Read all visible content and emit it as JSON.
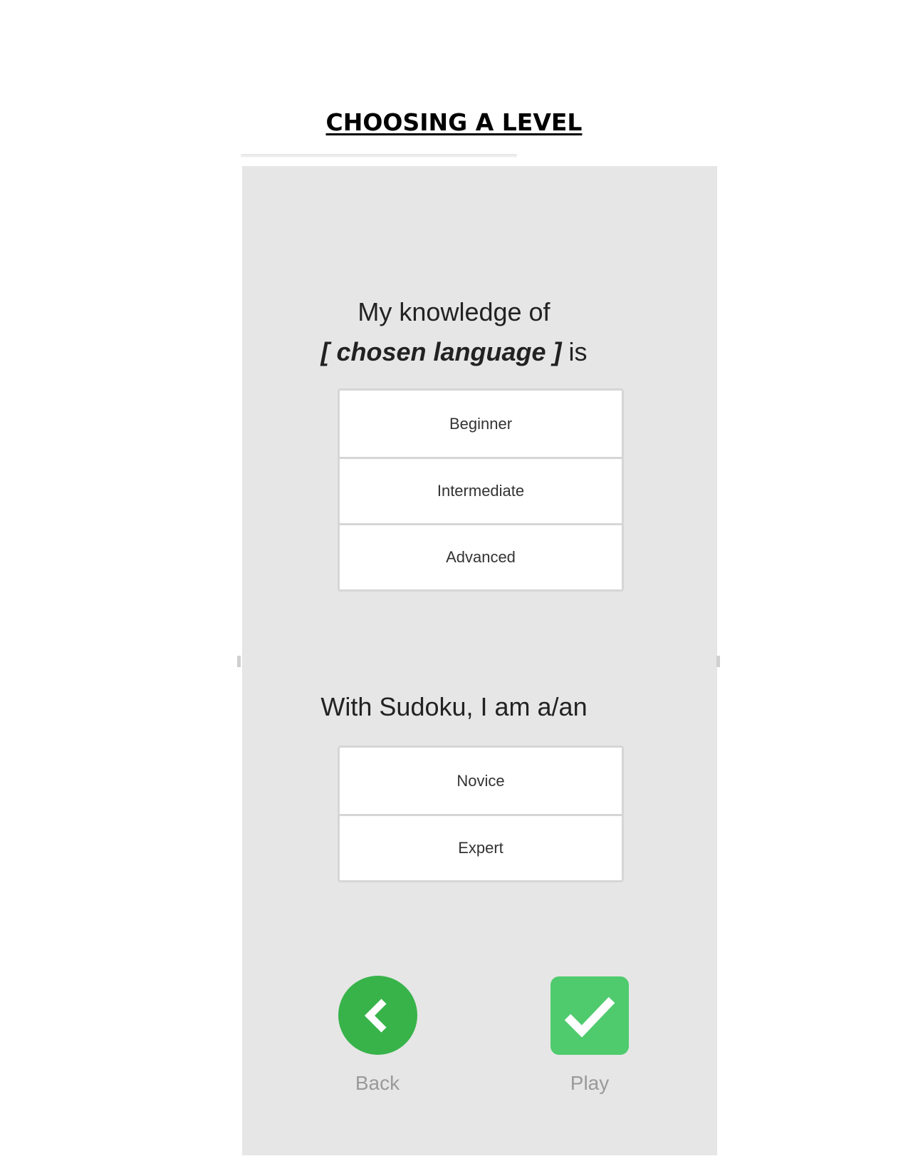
{
  "document": {
    "title": "CHOOSING A LEVEL"
  },
  "screen": {
    "language_question": {
      "line1": "My knowledge of",
      "emphasis": "[ chosen language ]",
      "suffix": " is"
    },
    "language_levels": [
      {
        "label": "Beginner"
      },
      {
        "label": "Intermediate"
      },
      {
        "label": "Advanced"
      }
    ],
    "sudoku_question": "With Sudoku, I am a/an",
    "sudoku_levels": [
      {
        "label": "Novice"
      },
      {
        "label": "Expert"
      }
    ],
    "actions": {
      "back_label": "Back",
      "back_icon": "chevron-left-icon",
      "play_label": "Play",
      "play_icon": "checkmark-icon"
    },
    "colors": {
      "background": "#e6e6e6",
      "back_button": "#38b34a",
      "play_button": "#4fcb6e"
    }
  }
}
